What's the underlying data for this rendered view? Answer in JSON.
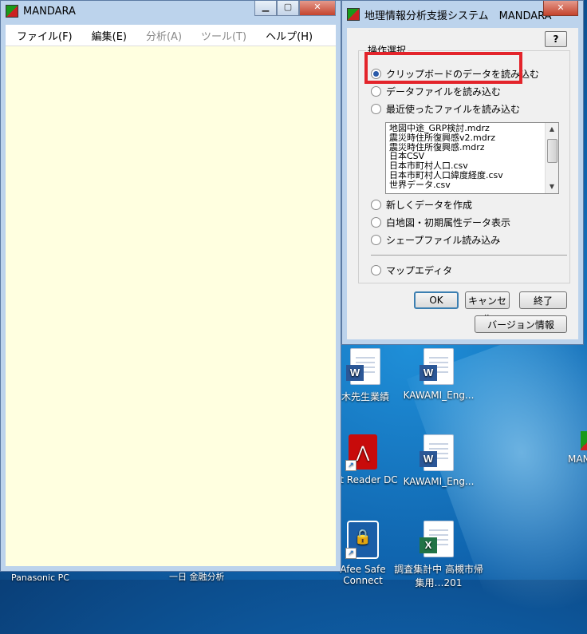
{
  "main_window": {
    "title": "MANDARA",
    "menu": [
      {
        "label": "ファイル(F)",
        "enabled": true
      },
      {
        "label": "編集(E)",
        "enabled": true
      },
      {
        "label": "分析(A)",
        "enabled": false
      },
      {
        "label": "ツール(T)",
        "enabled": false
      },
      {
        "label": "ヘルプ(H)",
        "enabled": true
      }
    ]
  },
  "dialog": {
    "title": "地理情報分析支援システム　MANDARA",
    "help_label": "?",
    "group_label": "操作選択",
    "options": [
      {
        "label": "クリップボードのデータを読み込む",
        "checked": true
      },
      {
        "label": "データファイルを読み込む",
        "checked": false
      },
      {
        "label": "最近使ったファイルを読み込む",
        "checked": false
      },
      {
        "label": "新しくデータを作成",
        "checked": false
      },
      {
        "label": "白地図・初期属性データ表示",
        "checked": false
      },
      {
        "label": "シェープファイル読み込み",
        "checked": false
      },
      {
        "label": "マップエディタ",
        "checked": false
      }
    ],
    "recent_files": [
      "地図中途_GRP検討.mdrz",
      "震災時住所復興感v2.mdrz",
      "震災時住所復興感.mdrz",
      "日本CSV",
      "日本市町村人口.csv",
      "日本市町村人口緯度経度.csv",
      "世界データ.csv"
    ],
    "buttons": {
      "ok": "OK",
      "cancel": "キャンセル",
      "exit": "終了",
      "version": "バージョン情報"
    }
  },
  "desktop": {
    "icons": [
      {
        "label": "木先生業績",
        "kind": "word"
      },
      {
        "label": "KAWAMI_Eng...",
        "kind": "word"
      },
      {
        "label": "bat Reader DC",
        "kind": "pdf"
      },
      {
        "label": "KAWAMI_Eng...",
        "kind": "word"
      },
      {
        "label": "Afee Safe Connect",
        "kind": "mcafee"
      },
      {
        "label": "調査集計中 高槻市帰集用…201",
        "kind": "excel"
      }
    ],
    "partial_icon_label": "MAN",
    "taskbar_labels": [
      "Panasonic PC",
      "一日 金融分析"
    ]
  },
  "colors": {
    "highlight": "#e3242b",
    "client_bg": "#ffffe0",
    "frame": "#bcd3ec"
  }
}
